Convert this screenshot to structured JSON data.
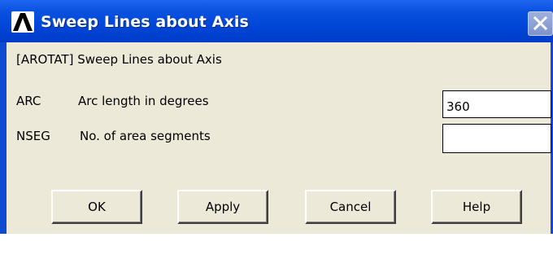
{
  "window": {
    "title": "Sweep Lines about Axis",
    "logo_icon": "ansys-logo-icon",
    "close_icon": "close-icon"
  },
  "dialog": {
    "command_label": "[AROTAT]  Sweep Lines about Axis",
    "fields": [
      {
        "key": "ARC",
        "description": "Arc length in degrees",
        "value": "360"
      },
      {
        "key": "NSEG",
        "description": "No. of area segments",
        "value": ""
      }
    ],
    "buttons": {
      "ok": "OK",
      "apply": "Apply",
      "cancel": "Cancel",
      "help": "Help"
    }
  },
  "colors": {
    "title_bar": "#0046d8",
    "dialog_face": "#ece9d8",
    "title_text": "#ffffff"
  }
}
